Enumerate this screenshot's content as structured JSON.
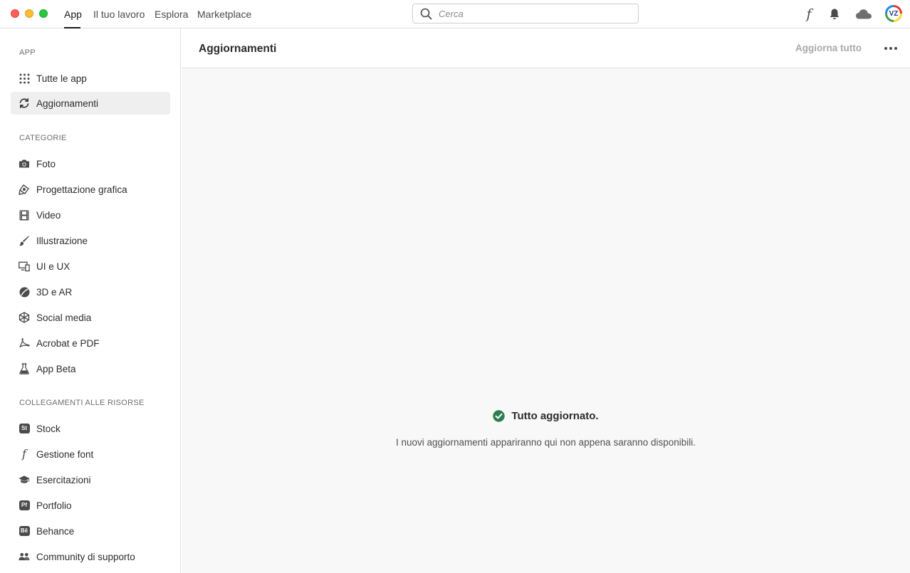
{
  "window": {
    "controls": [
      "close",
      "minimize",
      "maximize"
    ]
  },
  "nav": {
    "tabs": [
      {
        "label": "App",
        "active": true
      },
      {
        "label": "Il tuo lavoro",
        "active": false
      },
      {
        "label": "Esplora",
        "active": false
      },
      {
        "label": "Marketplace",
        "active": false
      }
    ]
  },
  "search": {
    "placeholder": "Cerca",
    "value": ""
  },
  "top_icons": {
    "font": "f",
    "bell": "bell-icon",
    "cloud": "cloud-icon",
    "avatar_initials": "VZ"
  },
  "sidebar": {
    "app_section": "APP",
    "app_items": [
      {
        "label": "Tutte le app",
        "icon": "grid-icon",
        "selected": false
      },
      {
        "label": "Aggiornamenti",
        "icon": "refresh-icon",
        "selected": true
      }
    ],
    "categories_section": "CATEGORIE",
    "category_items": [
      {
        "label": "Foto",
        "icon": "camera-icon"
      },
      {
        "label": "Progettazione grafica",
        "icon": "pen-tool-icon"
      },
      {
        "label": "Video",
        "icon": "film-icon"
      },
      {
        "label": "Illustrazione",
        "icon": "brush-icon"
      },
      {
        "label": "UI e UX",
        "icon": "devices-icon"
      },
      {
        "label": "3D e AR",
        "icon": "sphere-icon"
      },
      {
        "label": "Social media",
        "icon": "network-icon"
      },
      {
        "label": "Acrobat e PDF",
        "icon": "acrobat-icon"
      },
      {
        "label": "App Beta",
        "icon": "flask-icon"
      }
    ],
    "resources_section": "COLLEGAMENTI ALLE RISORSE",
    "resource_items": [
      {
        "label": "Stock",
        "icon": "stock-icon",
        "badge": "St"
      },
      {
        "label": "Gestione font",
        "icon": "font-icon",
        "badge": "f"
      },
      {
        "label": "Esercitazioni",
        "icon": "graduation-cap-icon"
      },
      {
        "label": "Portfolio",
        "icon": "portfolio-icon",
        "badge": "Pf"
      },
      {
        "label": "Behance",
        "icon": "behance-icon",
        "badge": "Bē"
      },
      {
        "label": "Community di supporto",
        "icon": "community-icon"
      }
    ]
  },
  "main": {
    "title": "Aggiornamenti",
    "update_all": "Aggiorna tutto",
    "status_title": "Tutto aggiornato.",
    "status_subtitle": "I nuovi aggiornamenti appariranno qui non appena saranno disponibili.",
    "status_color": "#2d7d4f"
  }
}
